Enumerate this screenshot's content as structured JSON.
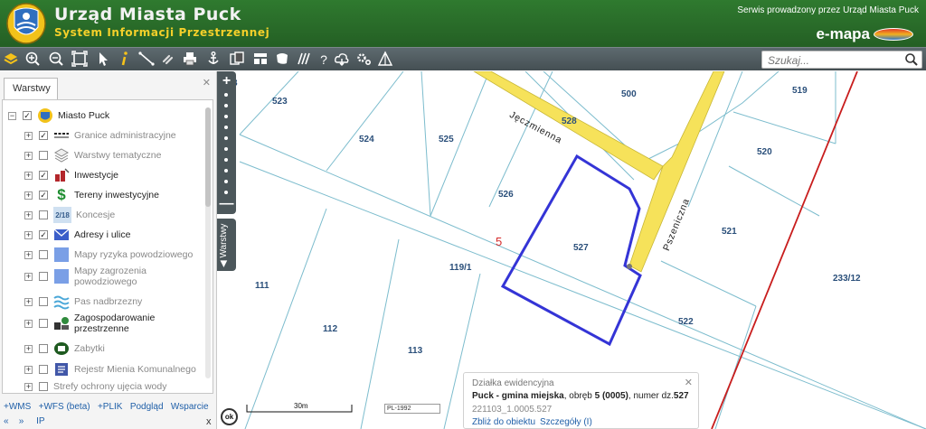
{
  "header": {
    "title": "Urząd Miasta Puck",
    "subtitle": "System Informacji Przestrzennej",
    "operator_text": "Serwis prowadzony przez Urząd Miasta Puck",
    "brand": "e-mapa",
    "colors": {
      "bar": "#2c6e2c",
      "subtitle": "#f5d02a"
    }
  },
  "toolbar": {
    "icons": [
      "layers-icon",
      "zoom-in-icon",
      "zoom-out-icon",
      "zoom-extent-icon",
      "select-arrow-icon",
      "info-icon",
      "measure-icon",
      "link-icon",
      "print-icon",
      "anchor-icon",
      "copy-icon",
      "layout-icon",
      "shape-icon",
      "hatch-icon",
      "help-icon",
      "cloud-icon",
      "gear-icon",
      "triangle-icon"
    ],
    "search_placeholder": "Szukaj..."
  },
  "panel": {
    "tab_label": "Warstwy",
    "root": "Miasto Puck",
    "items": [
      {
        "label": "Granice administracyjne",
        "checked": true,
        "active": false,
        "icon": "boundary-icon"
      },
      {
        "label": "Warstwy tematyczne",
        "checked": false,
        "active": false,
        "icon": "stack-icon"
      },
      {
        "label": "Inwestycje",
        "checked": true,
        "active": true,
        "icon": "investment-icon"
      },
      {
        "label": "Tereny inwestycyjne",
        "checked": true,
        "active": true,
        "icon": "dollar-icon"
      },
      {
        "label": "Koncesje",
        "checked": false,
        "active": false,
        "icon": "concession-icon",
        "icon_text": "2/18"
      },
      {
        "label": "Adresy i ulice",
        "checked": true,
        "active": true,
        "icon": "envelope-icon"
      },
      {
        "label": "Mapy ryzyka powodziowego",
        "checked": false,
        "active": false,
        "icon": "blue-square-icon"
      },
      {
        "label": "Mapy zagrozenia powodziowego",
        "checked": false,
        "active": false,
        "icon": "blue-square-icon"
      },
      {
        "label": "Pas nadbrzezny",
        "checked": false,
        "active": false,
        "icon": "waves-icon"
      },
      {
        "label": "Zagospodarowanie przestrzenne",
        "checked": false,
        "active": true,
        "icon": "planning-icon"
      },
      {
        "label": "Zabytki",
        "checked": false,
        "active": false,
        "icon": "monument-icon"
      },
      {
        "label": "Rejestr Mienia Komunalnego",
        "checked": false,
        "active": false,
        "icon": "register-icon"
      },
      {
        "label": "Strefy ochrony ujęcia wody",
        "checked": false,
        "active": false,
        "icon": "water-icon"
      }
    ],
    "links": [
      "+WMS",
      "+WFS (beta)",
      "+PLIK",
      "Podgląd",
      "Wsparcie"
    ],
    "links2": [
      "«",
      "»",
      "IP"
    ],
    "close_x": "x"
  },
  "map": {
    "side_tab": "Warstwy",
    "parcels": [
      "523",
      "524",
      "525",
      "500",
      "528",
      "519",
      "520",
      "526",
      "527",
      "521",
      "119/1",
      "111",
      "112",
      "113",
      "522",
      "233/12"
    ],
    "district": "5",
    "street_1": "Jęczmienna",
    "street_2": "Pszeniczna",
    "partial_label": "8",
    "scale": "30m",
    "crs": "PL-1992",
    "ok": "ok",
    "colors": {
      "parcel_line": "#74b7c9",
      "parcel_text": "#2a4f7a",
      "road": "#f6e25a",
      "selection": "#3434d6",
      "boundary": "#c81d1d"
    }
  },
  "popup": {
    "type": "Działka ewidencyjna",
    "main": "Puck - gmina miejska, obręb 5 (0005), numer dz.527",
    "main_bold_1": "Puck - gmina miejska",
    "main_mid": ", obręb ",
    "main_bold_2": "5 (0005)",
    "main_end": ", numer dz.",
    "main_bold_3": "527",
    "id": "221103_1.0005.527",
    "zoom_link": "Zbliż do obiektu",
    "details_link": "Szczegóły (I)"
  }
}
